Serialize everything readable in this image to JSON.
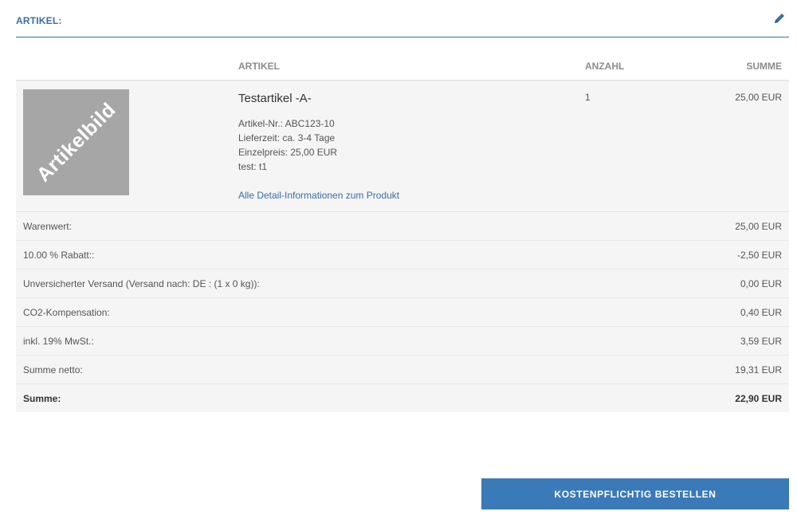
{
  "section": {
    "title": "ARTIKEL:",
    "edit_icon": "pencil-icon"
  },
  "table": {
    "headers": {
      "artikel": "ARTIKEL",
      "anzahl": "ANZAHL",
      "summe": "SUMME"
    }
  },
  "item": {
    "image_text": "Artikelbild",
    "name": "Testartikel -A-",
    "details": [
      "Artikel-Nr.: ABC123-10",
      "Lieferzeit: ca. 3-4 Tage",
      "Einzelpreis: 25,00 EUR",
      "test: t1"
    ],
    "detail_link": "Alle Detail-Informationen zum Produkt",
    "quantity": "1",
    "sum": "25,00 EUR"
  },
  "totals": [
    {
      "label": "Warenwert:",
      "value": "25,00 EUR"
    },
    {
      "label": "10.00 % Rabatt::",
      "value": "-2,50 EUR"
    },
    {
      "label": "Unversicherter Versand (Versand nach: DE : (1 x 0 kg)):",
      "value": "0,00 EUR"
    },
    {
      "label": "CO2-Kompensation:",
      "value": "0,40 EUR"
    },
    {
      "label": "inkl. 19% MwSt.:",
      "value": "3,59 EUR"
    },
    {
      "label": "Summe netto:",
      "value": "19,31 EUR"
    },
    {
      "label": "Summe:",
      "value": "22,90 EUR"
    }
  ],
  "order_button": "KOSTENPFLICHTIG BESTELLEN",
  "colors": {
    "accent": "#3a6ea5",
    "button": "#3a7ab8",
    "row_bg": "#f5f5f5",
    "thumb_bg": "#a6a6a6"
  }
}
